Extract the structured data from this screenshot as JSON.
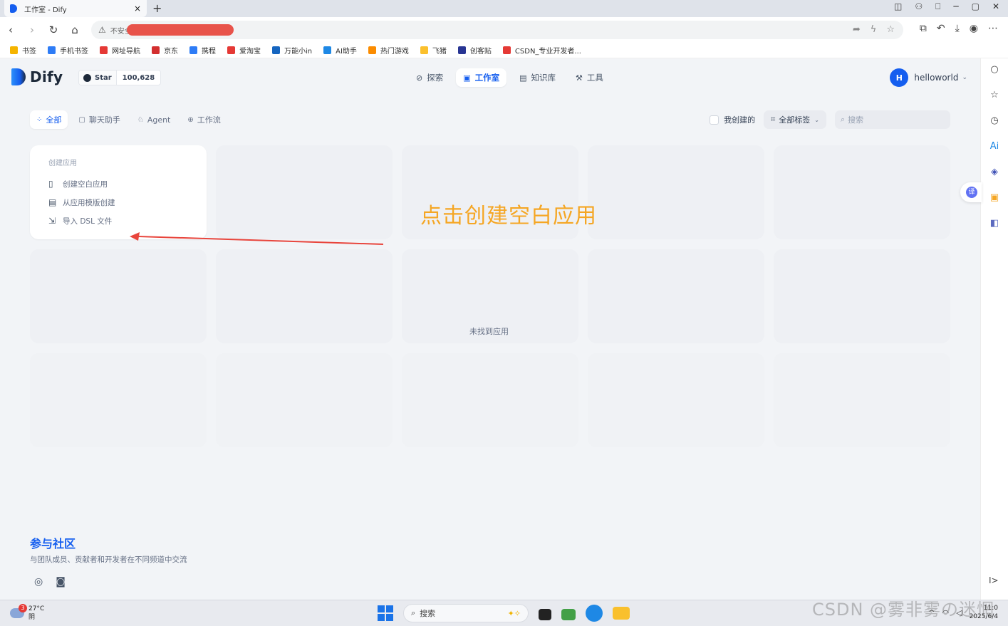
{
  "browser": {
    "tab_title": "工作室 - Dify",
    "tab_close": "×",
    "new_tab": "+",
    "address_warning": "不安全",
    "bookmarks": [
      {
        "label": "书签",
        "color": "#f5b400"
      },
      {
        "label": "手机书签",
        "color": "#2e7cf6"
      },
      {
        "label": "网址导航",
        "color": "#e53935"
      },
      {
        "label": "京东",
        "color": "#d32f2f"
      },
      {
        "label": "携程",
        "color": "#2e7cf6"
      },
      {
        "label": "爱淘宝",
        "color": "#e53935"
      },
      {
        "label": "万能小in",
        "color": "#1565c0"
      },
      {
        "label": "AI助手",
        "color": "#1e88e5"
      },
      {
        "label": "热门游戏",
        "color": "#fb8c00"
      },
      {
        "label": "飞猪",
        "color": "#fbc02d"
      },
      {
        "label": "创客贴",
        "color": "#283593"
      },
      {
        "label": "CSDN_专业开发者...",
        "color": "#e53935"
      }
    ]
  },
  "app": {
    "logo_text": "Dify",
    "github_star_label": "Star",
    "github_star_count": "100,628",
    "nav": [
      {
        "label": "探索",
        "icon": "⊘",
        "active": false
      },
      {
        "label": "工作室",
        "icon": "▣",
        "active": true
      },
      {
        "label": "知识库",
        "icon": "▤",
        "active": false
      },
      {
        "label": "工具",
        "icon": "⚒",
        "active": false
      }
    ],
    "account": {
      "initial": "H",
      "name": "helloworld"
    },
    "filter_tabs": [
      {
        "label": "全部",
        "icon": "⁘",
        "active": true
      },
      {
        "label": "聊天助手",
        "icon": "▢",
        "active": false
      },
      {
        "label": "Agent",
        "icon": "♘",
        "active": false
      },
      {
        "label": "工作流",
        "icon": "⊕",
        "active": false
      }
    ],
    "mine_label": "我创建的",
    "tags_label": "全部标签",
    "search_placeholder": "搜索",
    "create": {
      "title": "创建应用",
      "items": [
        {
          "label": "创建空白应用",
          "icon": "▯"
        },
        {
          "label": "从应用模版创建",
          "icon": "▤"
        },
        {
          "label": "导入 DSL 文件",
          "icon": "⇲"
        }
      ]
    },
    "empty_message": "未找到应用",
    "community_title": "参与社区",
    "community_desc": "与团队成员、贡献者和开发者在不同频道中交流"
  },
  "annotation": {
    "text": "点击创建空白应用",
    "color": "#f5a623",
    "arrow_color": "#e8453c"
  },
  "taskbar": {
    "weather_temp": "27°C",
    "weather_desc": "阴",
    "weather_badge": "3",
    "search_label": "搜索",
    "time": "11:0",
    "date": "2025/6/4"
  },
  "watermark": "CSDN @雾非雾の迷惘"
}
